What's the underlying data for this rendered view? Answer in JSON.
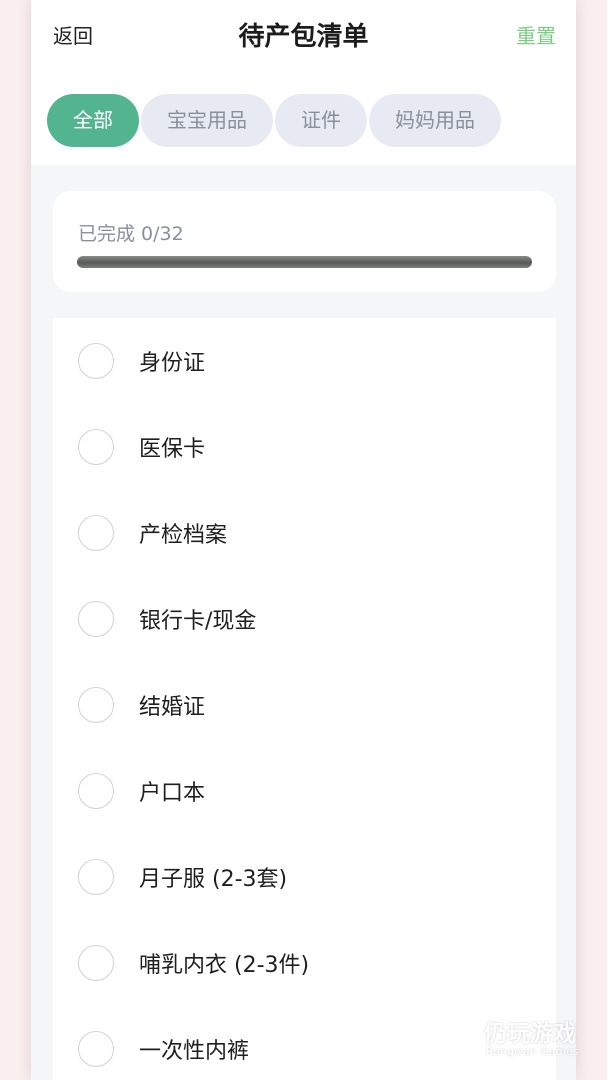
{
  "header": {
    "back_label": "返回",
    "title": "待产包清单",
    "reset_label": "重置"
  },
  "tabs": [
    {
      "label": "全部",
      "active": true
    },
    {
      "label": "宝宝用品",
      "active": false
    },
    {
      "label": "证件",
      "active": false
    },
    {
      "label": "妈妈用品",
      "active": false
    }
  ],
  "progress": {
    "text": "已完成 0/32",
    "completed": 0,
    "total": 32
  },
  "checklist": [
    {
      "label": "身份证",
      "checked": false
    },
    {
      "label": "医保卡",
      "checked": false
    },
    {
      "label": "产检档案",
      "checked": false
    },
    {
      "label": "银行卡/现金",
      "checked": false
    },
    {
      "label": "结婚证",
      "checked": false
    },
    {
      "label": "户口本",
      "checked": false
    },
    {
      "label": "月子服 (2-3套)",
      "checked": false
    },
    {
      "label": "哺乳内衣 (2-3件)",
      "checked": false
    },
    {
      "label": "一次性内裤",
      "checked": false
    }
  ],
  "watermark": {
    "cn": "仍玩游戏",
    "en": "Rengwan Games"
  },
  "colors": {
    "accent": "#52b590",
    "reset": "#7ccd84",
    "tab_inactive_bg": "#e8eaf3",
    "tab_inactive_text": "#8a8f9c"
  }
}
